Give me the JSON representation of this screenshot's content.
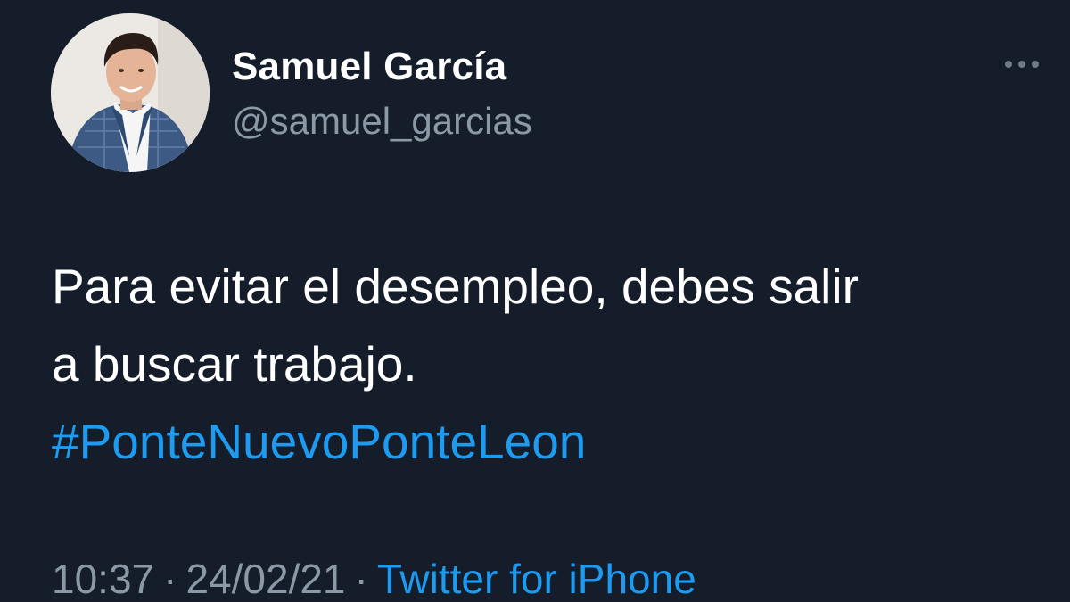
{
  "user": {
    "display_name": "Samuel García",
    "handle": "@samuel_garcias",
    "avatar_icon": "profile-photo"
  },
  "tweet": {
    "text_line_1": "Para evitar el desempleo, debes salir",
    "text_line_2": "a buscar trabajo.",
    "hashtag": "#PonteNuevoPonteLeon"
  },
  "meta": {
    "time": "10:37",
    "separator": "·",
    "date": "24/02/21",
    "source": "Twitter for iPhone"
  },
  "icons": {
    "more": "more-horizontal-icon"
  },
  "colors": {
    "background": "#151d2a",
    "link": "#1d9bf0",
    "secondary_text": "#8b98a5"
  }
}
